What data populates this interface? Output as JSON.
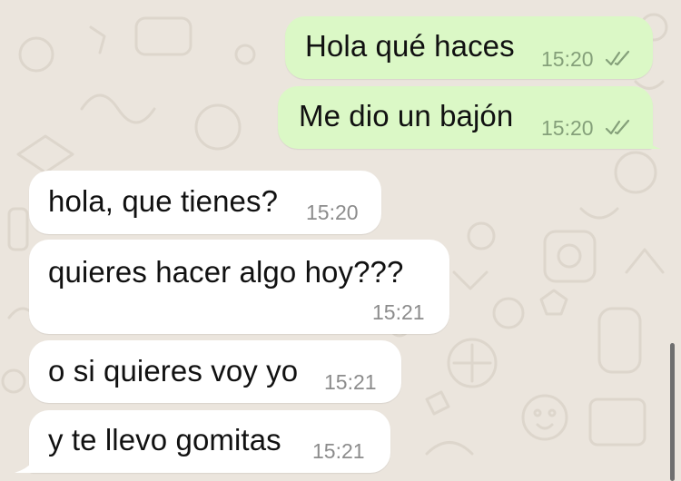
{
  "colors": {
    "background": "#ebe5dd",
    "outgoing_bubble": "#dbf8c6",
    "incoming_bubble": "#ffffff",
    "timestamp": "#8c8c8c"
  },
  "messages": [
    {
      "direction": "outgoing",
      "text": "Hola qué haces",
      "time": "15:20",
      "status": "read-double-check-icon"
    },
    {
      "direction": "outgoing",
      "text": "Me dio un bajón",
      "time": "15:20",
      "status": "read-double-check-icon"
    },
    {
      "direction": "incoming",
      "text": "hola, que tienes?",
      "time": "15:20"
    },
    {
      "direction": "incoming",
      "text": "quieres hacer algo hoy???",
      "time": "15:21"
    },
    {
      "direction": "incoming",
      "text": "o si quieres voy yo",
      "time": "15:21"
    },
    {
      "direction": "incoming",
      "text": "y te llevo gomitas",
      "time": "15:21"
    }
  ]
}
